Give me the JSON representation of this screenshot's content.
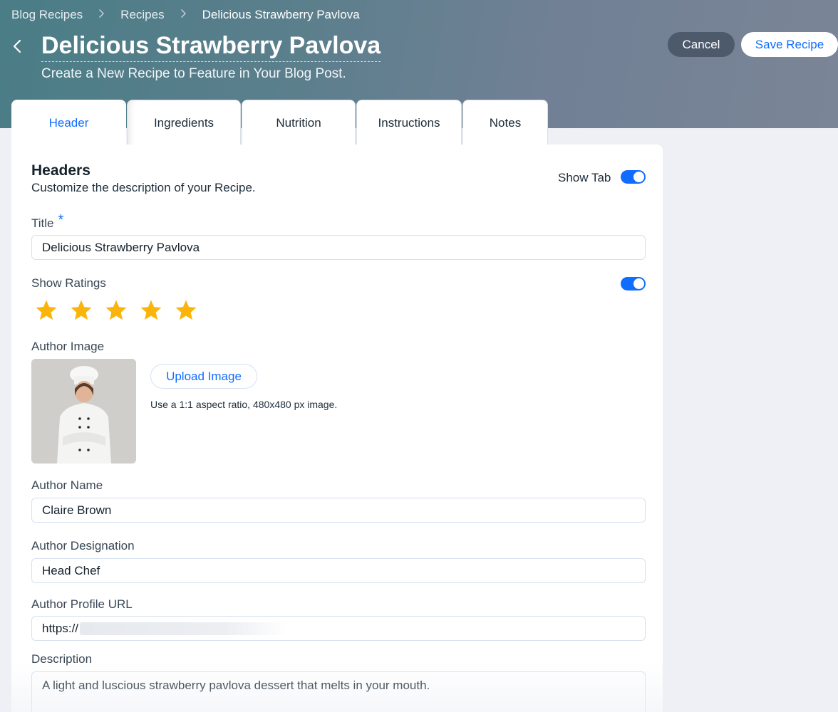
{
  "breadcrumb": {
    "items": [
      "Blog Recipes",
      "Recipes",
      "Delicious Strawberry Pavlova"
    ]
  },
  "header": {
    "title": "Delicious Strawberry Pavlova",
    "subtitle": "Create a New Recipe to Feature in Your Blog Post.",
    "cancel_label": "Cancel",
    "save_label": "Save Recipe"
  },
  "tabs": [
    {
      "label": "Header",
      "active": true
    },
    {
      "label": "Ingredients",
      "active": false
    },
    {
      "label": "Nutrition",
      "active": false
    },
    {
      "label": "Instructions",
      "active": false
    },
    {
      "label": "Notes",
      "active": false
    }
  ],
  "section": {
    "title": "Headers",
    "description": "Customize the description of your Recipe.",
    "show_tab_label": "Show Tab",
    "show_tab_on": true
  },
  "form": {
    "title_label": "Title",
    "required_mark": "*",
    "title_value": "Delicious Strawberry Pavlova",
    "show_ratings_label": "Show Ratings",
    "show_ratings_on": true,
    "rating": 5,
    "rating_max": 5,
    "author_image_label": "Author Image",
    "upload_label": "Upload Image",
    "upload_hint": "Use a 1:1 aspect ratio, 480x480 px image.",
    "author_name_label": "Author Name",
    "author_name_value": "Claire Brown",
    "author_designation_label": "Author Designation",
    "author_designation_value": "Head Chef",
    "author_url_label": "Author Profile URL",
    "author_url_value": "https://",
    "description_label": "Description",
    "description_value": "A light and luscious strawberry pavlova dessert that melts in your mouth."
  },
  "colors": {
    "accent": "#116dff",
    "star": "#fbb50a",
    "cancel_bg": "#4d5a6b"
  },
  "icons": {
    "back": "chevron-left-icon",
    "breadcrumb_separator": "chevron-right-icon",
    "rating": "star-icon"
  }
}
